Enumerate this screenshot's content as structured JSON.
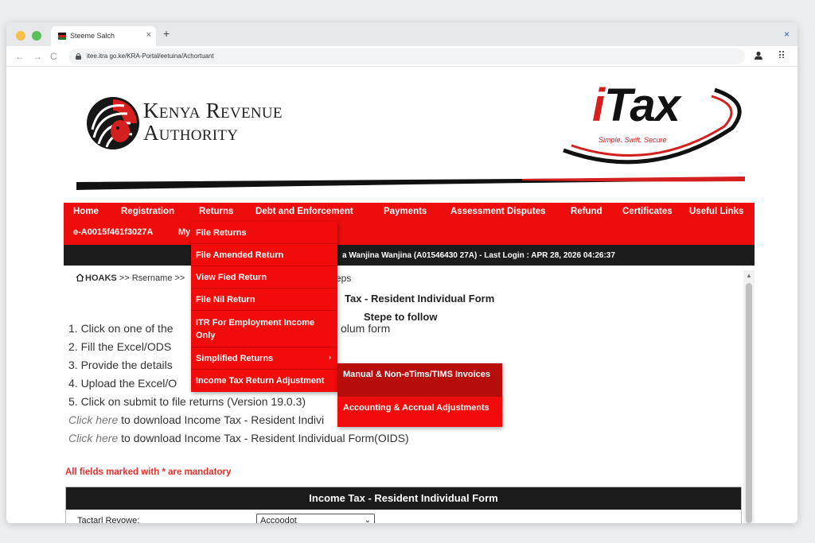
{
  "browser": {
    "tab_title": "Steeme Salch",
    "tab_close": "×",
    "new_tab": "+",
    "window_close": "×",
    "url": "itee.itra go.ke/KRA-Portal/eetuina/Achortuant",
    "back": "←",
    "forward": "→",
    "reload": "C"
  },
  "header": {
    "org_name_line1": "Kenya Revenue",
    "org_name_line2": "Authority",
    "itax_i": "i",
    "itax_rest": "Tax",
    "itax_tagline": "Simple. Swift. Secure"
  },
  "nav": {
    "items": [
      "Home",
      "Registration",
      "Returns",
      "Debt and Enforcement",
      "Payments",
      "Assessment Disputes",
      "Refund",
      "Certificates",
      "Useful Links"
    ],
    "pin": "e-A0015f461f3027A",
    "my": "My",
    "welcome": "a Wanjina Wanjina (A01546430 27A)  - Last Login : APR 28, 2026 04:26:37"
  },
  "returns_menu": {
    "items": [
      "File Returns",
      "File Amended Return",
      "View Fied Return",
      "File Nil Return",
      "ITR For Employment Income Only",
      "Simplified Returns",
      "Income Tax Return Adjustment"
    ],
    "submenu": [
      "Manual & Non-eTims/TIMS Invoices",
      "Accounting & Accrual Adjustments"
    ]
  },
  "breadcrumb": {
    "home": "HOAKS",
    "rest": " >> Rsername >>",
    "tail": "eps"
  },
  "content": {
    "form_title": "Tax - Resident Individual Form",
    "steps_title": "Stepe to follow",
    "step1": "1. Click on one of the",
    "step1_tail": "olum form",
    "step2": "2. Fill the Excel/ODS",
    "step3": "3. Provide the details",
    "step4": "4. Upload the Excel/O",
    "step5": "5. Click on submit to file returns (Version 19.0.3)",
    "click_here": "Click here",
    "dl1_rest": " to download Income Tax - Resident Indivi",
    "dl2_rest": " to download Income Tax - Resident Individual Form(OIDS)",
    "mandatory": "All fields marked with * are mandatory"
  },
  "form": {
    "header": "Income Tax - Resident Individual Form",
    "field_label": "Tactarl Revowe:",
    "field_value": "Accoodot"
  },
  "colors": {
    "kra_red": "#ee0d0d",
    "dark_bar": "#1c1c1c",
    "submenu_active": "#b80d0d",
    "mandatory_red": "#e3302b"
  }
}
